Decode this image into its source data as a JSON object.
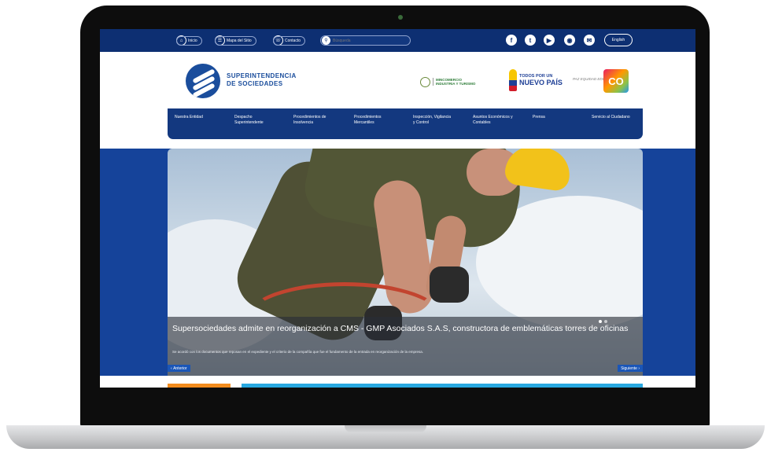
{
  "topbar": {
    "links": [
      {
        "icon": "home-icon",
        "label": "Inicio"
      },
      {
        "icon": "sitemap-icon",
        "label": "Mapa del Sitio"
      },
      {
        "icon": "contact-icon",
        "label": "Contacto"
      }
    ],
    "search_placeholder": "Búsqueda",
    "social": [
      {
        "icon": "facebook-icon",
        "glyph": "f"
      },
      {
        "icon": "twitter-icon",
        "glyph": "t"
      },
      {
        "icon": "youtube-icon",
        "glyph": "▶"
      },
      {
        "icon": "flickr-icon",
        "glyph": "◉"
      },
      {
        "icon": "tumblr-icon",
        "glyph": "✉"
      }
    ],
    "language": "English"
  },
  "header": {
    "logo_line1": "SUPERINTENDENCIA",
    "logo_line2": "DE SOCIEDADES",
    "ministry_line1": "MINCOMERCIO",
    "ministry_line2": "INDUSTRIA Y TURISMO",
    "todos_line1": "TODOS POR UN",
    "todos_line2": "NUEVO PAÍS",
    "tagline": "PAZ EQUIDAD EDUCACIÓN",
    "co_badge": "CO"
  },
  "nav": {
    "items": [
      "Nuestra Entidad",
      "Despacho Superintendente",
      "Procedimientos de Insolvencia",
      "Procedimientos Mercantiles",
      "Inspección, Vigilancia y Control",
      "Asuntos Económicos y Contables",
      "Prensa",
      "Servicio al Ciudadano"
    ]
  },
  "hero": {
    "title": "Supersociedades admite en reorganización a CMS - GMP Asociados S.A.S, constructora de emblemáticas torres de oficinas",
    "subtitle": "Se acordó con los documentos que reposan en el expediente y el criterio de la compañía que fue el fundamento de la entrada en reorganización de la empresa.",
    "prev_label": "Anterior",
    "next_label": "Siguiente",
    "slides_total": 2,
    "slide_active": 1
  },
  "colors": {
    "topbar": "#0d2f72",
    "nav": "#13387f",
    "brand_blue": "#1a4d9c",
    "accent_orange": "#f28c1e",
    "accent_cyan": "#29a8e0"
  }
}
